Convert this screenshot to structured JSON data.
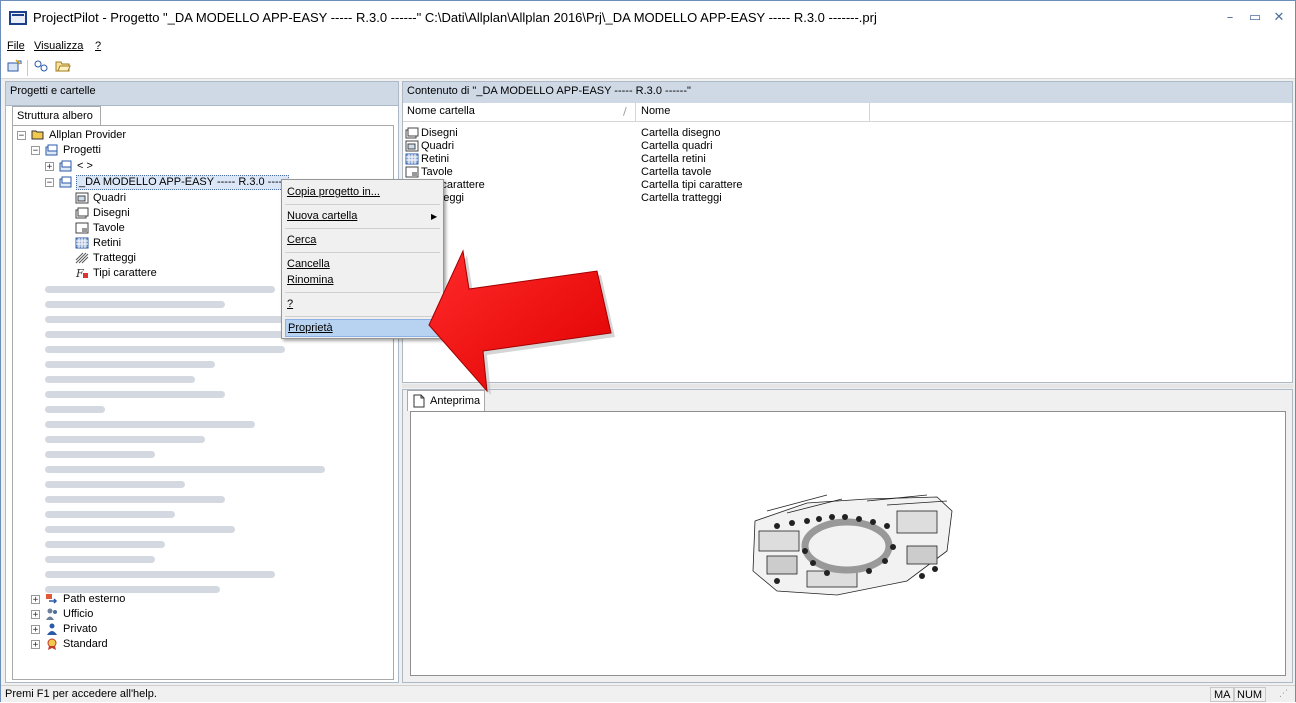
{
  "window": {
    "title": "ProjectPilot - Progetto \"_DA MODELLO APP-EASY ----- R.3.0 ------\" C:\\Dati\\Allplan\\Allplan 2016\\Prj\\_DA MODELLO APP-EASY ----- R.3.0 -------.prj",
    "minimize": "–",
    "maximize": "▭",
    "close": "✕"
  },
  "menu": {
    "file": "File",
    "view": "Visualizza",
    "help": "?"
  },
  "toolbar": {
    "icons": [
      "new-project-icon",
      "project-settings-icon",
      "open-folder-icon"
    ]
  },
  "left_pane": {
    "header": "Progetti e cartelle",
    "tab": "Struttura albero",
    "tree": {
      "root": "Allplan Provider",
      "projects": "Progetti",
      "placeholder_project": "<       >",
      "selected_project": "_DA MODELLO APP-EASY ----- R.3.0 -----",
      "children": [
        "Quadri",
        "Disegni",
        "Tavole",
        "Retini",
        "Tratteggi",
        "Tipi carattere"
      ],
      "bottom": [
        "Path esterno",
        "Ufficio",
        "Privato",
        "Standard"
      ]
    }
  },
  "content_pane": {
    "header": "Contenuto di \"_DA MODELLO APP-EASY ----- R.3.0 ------\"",
    "col_folder": "Nome cartella",
    "col_name": "Nome",
    "rows": [
      {
        "folder": "Disegni",
        "name": "Cartella disegno"
      },
      {
        "folder": "Quadri",
        "name": "Cartella quadri"
      },
      {
        "folder": "Retini",
        "name": "Cartella retini"
      },
      {
        "folder": "Tavole",
        "name": "Cartella tavole"
      },
      {
        "folder": "Tipi carattere",
        "name": "Cartella tipi carattere"
      },
      {
        "folder": "Tratteggi",
        "name": "Cartella tratteggi"
      }
    ]
  },
  "preview": {
    "tab": "Anteprima"
  },
  "context_menu": {
    "copy": "Copia progetto in...",
    "new_folder": "Nuova cartella",
    "search": "Cerca",
    "delete": "Cancella",
    "rename": "Rinomina",
    "help": "?",
    "properties": "Proprietà"
  },
  "status": {
    "help_text": "Premi F1 per accedere all'help.",
    "caps": "MA",
    "num": "NUM"
  },
  "colors": {
    "highlight": "#b8d3f2",
    "arrow": "#f20000",
    "header": "#cfd9e6"
  }
}
